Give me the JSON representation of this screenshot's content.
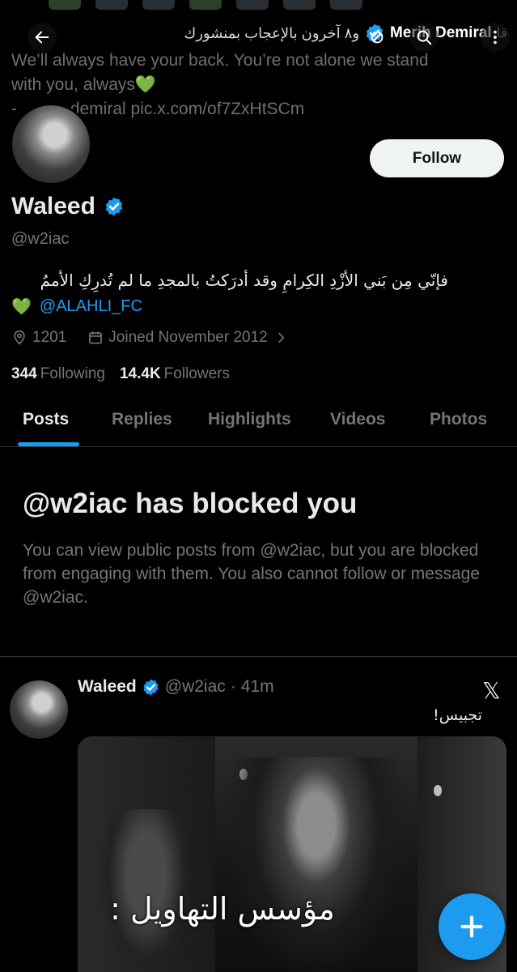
{
  "banner": {
    "header_name": "Merih Demiral",
    "header_likes": "و٨ آخرون بالإعجاب بمنشورك",
    "header_prefix": "قا",
    "quote_text": "We’ll always have your back. You’re not alone we stand with you, always💚",
    "quote_link_prefix": "- ",
    "quote_link": "demiral pic.x.com/of7ZxHtSCm"
  },
  "nav": {
    "back_icon": "arrow-left-icon",
    "search_icon": "search-icon",
    "more_icon": "more-vertical-icon"
  },
  "profile": {
    "follow_label": "Follow",
    "name": "Waleed",
    "handle": "@w2iac",
    "bio_line1": "فإنّي مِن بَني الأزْدِ الكِرامِ وقد أدرَكتُ بالمجدِ ما لم تُدرِكِ الأممُ",
    "bio_emoji": "💚",
    "bio_mention": "@ALAHLI_FC",
    "location": "1201",
    "joined": "Joined November 2012",
    "following_count": "344",
    "following_label": "Following",
    "followers_count": "14.4K",
    "followers_label": "Followers"
  },
  "tabs": [
    "Posts",
    "Replies",
    "Highlights",
    "Videos",
    "Photos"
  ],
  "blocked": {
    "title": "@w2iac has blocked you",
    "description": "You can view public posts from @w2iac, but you are blocked from engaging with them. You also cannot follow or message @w2iac."
  },
  "tweet": {
    "name": "Waleed",
    "handle": "@w2iac",
    "time": "41m",
    "dot": "·",
    "source_icon": "x-logo-icon",
    "text": "تجبيس!",
    "media_caption": "مؤسس التهاويل :"
  },
  "fab": {
    "icon": "plus-icon"
  },
  "colors": {
    "accent": "#1d9bf0",
    "background": "#000000",
    "muted": "#71767b"
  }
}
